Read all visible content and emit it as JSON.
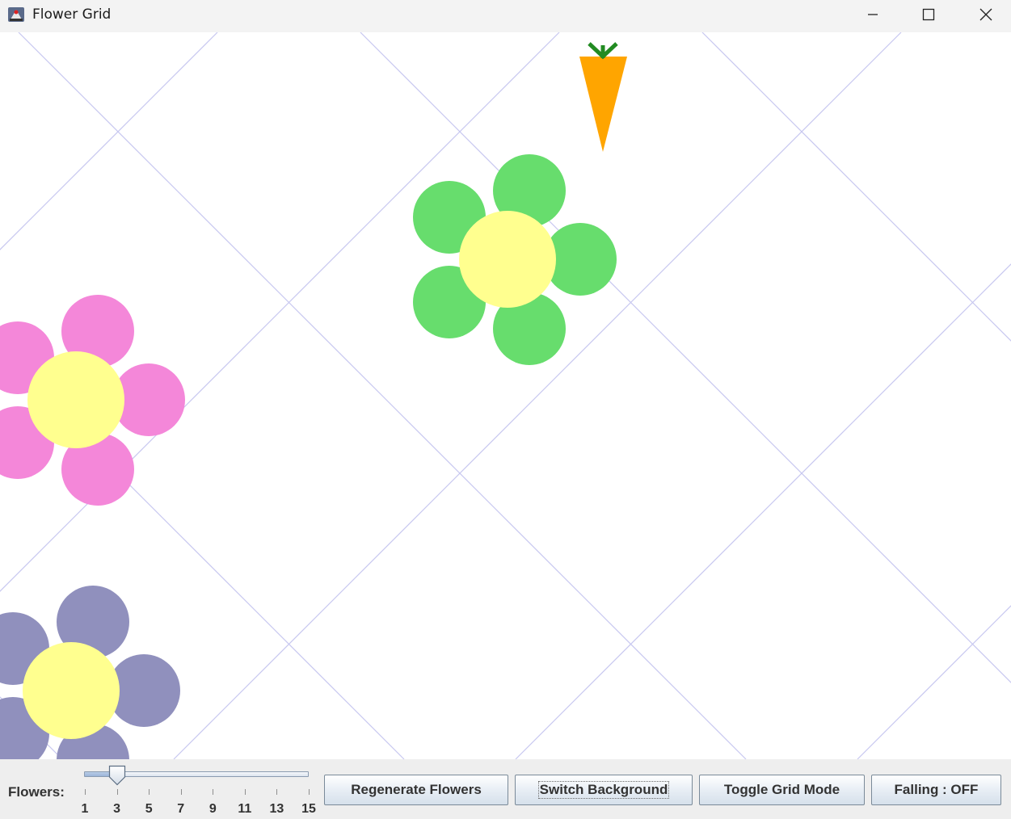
{
  "window": {
    "title": "Flower Grid",
    "icon": "java-app-icon",
    "controls": [
      "minimize-icon",
      "maximize-icon",
      "close-icon"
    ]
  },
  "canvas": {
    "background_color": "#ffffff",
    "grid_line_color": "#c8c8f0",
    "grid_mode": "diagonal",
    "flowers": [
      {
        "name": "green",
        "petal_color": "#67dd6d",
        "center_color": "#ffff8f"
      },
      {
        "name": "pink",
        "petal_color": "#f487d9",
        "center_color": "#ffff8f"
      },
      {
        "name": "purple",
        "petal_color": "#9090bd",
        "center_color": "#ffff8f"
      }
    ],
    "carrot": {
      "body_color": "#ffa500",
      "leaf_color": "#228b22"
    }
  },
  "controls": {
    "flowers_label": "Flowers:",
    "slider": {
      "min": 1,
      "max": 15,
      "value": 3,
      "tick_labels": [
        "1",
        "3",
        "5",
        "7",
        "9",
        "11",
        "13",
        "15"
      ]
    },
    "buttons": {
      "regenerate": "Regenerate Flowers",
      "switch_background": "Switch Background",
      "toggle_grid": "Toggle Grid Mode",
      "falling": "Falling : OFF"
    }
  }
}
